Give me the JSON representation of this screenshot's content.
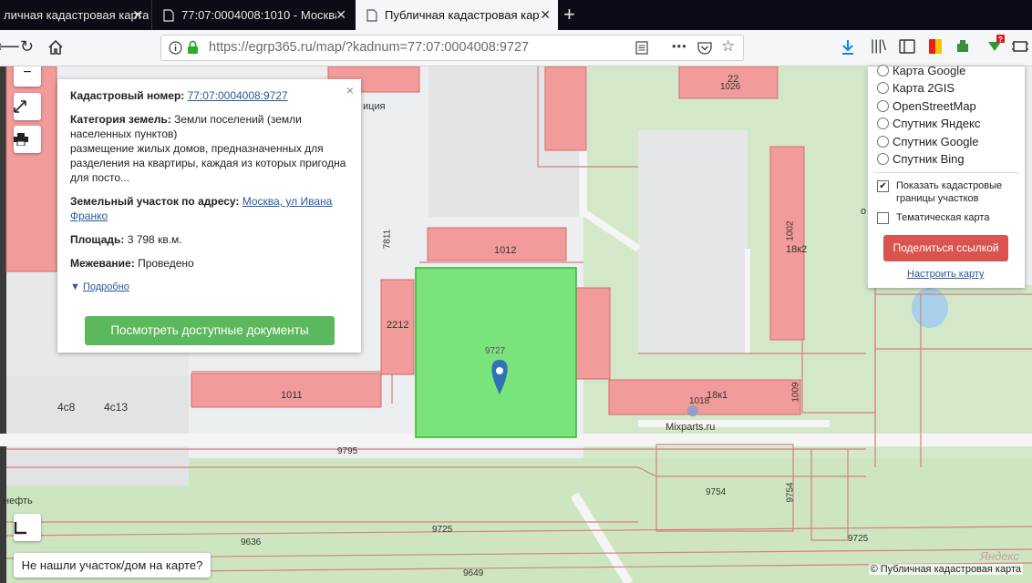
{
  "browser": {
    "tabs": [
      {
        "title": "личная кадастровая карта",
        "active": false
      },
      {
        "title": "77:07:0004008:1010 - Москва,",
        "active": false
      },
      {
        "title": "Публичная кадастровая карта",
        "active": true
      }
    ],
    "url": "https://egrp365.ru/map/?kadnum=77:07:0004008:9727",
    "menu_dots": "•••",
    "notification_badge": "?"
  },
  "map": {
    "labels": {
      "building_1012": "1012",
      "building_2212": "2212",
      "building_1011": "1011",
      "building_1018": "1018",
      "building_18x1": "18к1",
      "building_18x2": "18к2",
      "building_1026": "1026",
      "building_22": "22",
      "building_1002": "1002",
      "building_1009": "1009",
      "building_7811": "7811",
      "parcel_9727": "9727",
      "parcel_9795": "9795",
      "parcel_9754a": "9754",
      "parcel_9754b": "9754",
      "parcel_9725a": "9725",
      "parcel_9725b": "9725",
      "parcel_9636": "9636",
      "parcel_9649": "9649",
      "label_4c8": "4с8",
      "label_4c13": "4с13",
      "label_police": "иция",
      "label_neft": "нефть",
      "label_o": "о",
      "label_mixparts": "Mixparts.ru"
    },
    "zoom_out": "−",
    "yandex_logo": "Яндекс",
    "copyright": "© Публичная кадастровая карта"
  },
  "popup": {
    "cadnum_label": "Кадастровый номер:",
    "cadnum_value": "77:07:0004008:9727",
    "category_label": "Категория земель:",
    "category_value": "Земли поселений (земли населенных пунктов)",
    "usage_text": "размещение жилых домов, предназначенных для разделения на квартиры, каждая из которых пригодна для посто...",
    "address_label": "Земельный участок по адресу:",
    "address_value": "Москва, ул Ивана Франко",
    "area_label": "Площадь:",
    "area_value": "3 798 кв.м.",
    "survey_label": "Межевание:",
    "survey_value": "Проведено",
    "more_link": "Подробно",
    "docs_button": "Посмотреть доступные документы",
    "close": "×"
  },
  "layers": {
    "options": [
      "Карта Google",
      "Карта 2GIS",
      "OpenStreetMap",
      "Спутник Яндекс",
      "Спутник Google",
      "Спутник Bing"
    ],
    "show_borders_label": "Показать кадастровые границы участков",
    "show_borders_checked": true,
    "thematic_label": "Тематическая карта",
    "thematic_checked": false,
    "share_button": "Поделиться ссылкой",
    "configure_link": "Настроить карту"
  },
  "not_found_button": "Не нашли участок/дом на карте?"
}
